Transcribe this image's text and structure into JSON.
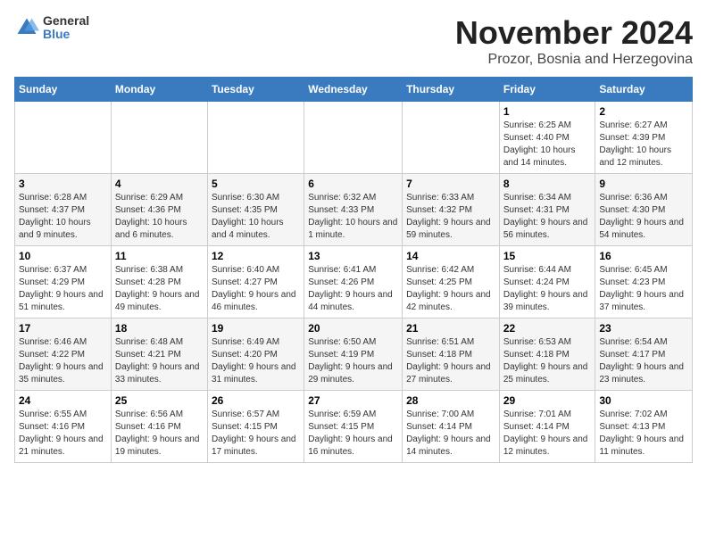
{
  "logo": {
    "general": "General",
    "blue": "Blue"
  },
  "header": {
    "title": "November 2024",
    "subtitle": "Prozor, Bosnia and Herzegovina"
  },
  "weekdays": [
    "Sunday",
    "Monday",
    "Tuesday",
    "Wednesday",
    "Thursday",
    "Friday",
    "Saturday"
  ],
  "weeks": [
    [
      {
        "day": "",
        "details": ""
      },
      {
        "day": "",
        "details": ""
      },
      {
        "day": "",
        "details": ""
      },
      {
        "day": "",
        "details": ""
      },
      {
        "day": "",
        "details": ""
      },
      {
        "day": "1",
        "details": "Sunrise: 6:25 AM\nSunset: 4:40 PM\nDaylight: 10 hours and 14 minutes."
      },
      {
        "day": "2",
        "details": "Sunrise: 6:27 AM\nSunset: 4:39 PM\nDaylight: 10 hours and 12 minutes."
      }
    ],
    [
      {
        "day": "3",
        "details": "Sunrise: 6:28 AM\nSunset: 4:37 PM\nDaylight: 10 hours and 9 minutes."
      },
      {
        "day": "4",
        "details": "Sunrise: 6:29 AM\nSunset: 4:36 PM\nDaylight: 10 hours and 6 minutes."
      },
      {
        "day": "5",
        "details": "Sunrise: 6:30 AM\nSunset: 4:35 PM\nDaylight: 10 hours and 4 minutes."
      },
      {
        "day": "6",
        "details": "Sunrise: 6:32 AM\nSunset: 4:33 PM\nDaylight: 10 hours and 1 minute."
      },
      {
        "day": "7",
        "details": "Sunrise: 6:33 AM\nSunset: 4:32 PM\nDaylight: 9 hours and 59 minutes."
      },
      {
        "day": "8",
        "details": "Sunrise: 6:34 AM\nSunset: 4:31 PM\nDaylight: 9 hours and 56 minutes."
      },
      {
        "day": "9",
        "details": "Sunrise: 6:36 AM\nSunset: 4:30 PM\nDaylight: 9 hours and 54 minutes."
      }
    ],
    [
      {
        "day": "10",
        "details": "Sunrise: 6:37 AM\nSunset: 4:29 PM\nDaylight: 9 hours and 51 minutes."
      },
      {
        "day": "11",
        "details": "Sunrise: 6:38 AM\nSunset: 4:28 PM\nDaylight: 9 hours and 49 minutes."
      },
      {
        "day": "12",
        "details": "Sunrise: 6:40 AM\nSunset: 4:27 PM\nDaylight: 9 hours and 46 minutes."
      },
      {
        "day": "13",
        "details": "Sunrise: 6:41 AM\nSunset: 4:26 PM\nDaylight: 9 hours and 44 minutes."
      },
      {
        "day": "14",
        "details": "Sunrise: 6:42 AM\nSunset: 4:25 PM\nDaylight: 9 hours and 42 minutes."
      },
      {
        "day": "15",
        "details": "Sunrise: 6:44 AM\nSunset: 4:24 PM\nDaylight: 9 hours and 39 minutes."
      },
      {
        "day": "16",
        "details": "Sunrise: 6:45 AM\nSunset: 4:23 PM\nDaylight: 9 hours and 37 minutes."
      }
    ],
    [
      {
        "day": "17",
        "details": "Sunrise: 6:46 AM\nSunset: 4:22 PM\nDaylight: 9 hours and 35 minutes."
      },
      {
        "day": "18",
        "details": "Sunrise: 6:48 AM\nSunset: 4:21 PM\nDaylight: 9 hours and 33 minutes."
      },
      {
        "day": "19",
        "details": "Sunrise: 6:49 AM\nSunset: 4:20 PM\nDaylight: 9 hours and 31 minutes."
      },
      {
        "day": "20",
        "details": "Sunrise: 6:50 AM\nSunset: 4:19 PM\nDaylight: 9 hours and 29 minutes."
      },
      {
        "day": "21",
        "details": "Sunrise: 6:51 AM\nSunset: 4:18 PM\nDaylight: 9 hours and 27 minutes."
      },
      {
        "day": "22",
        "details": "Sunrise: 6:53 AM\nSunset: 4:18 PM\nDaylight: 9 hours and 25 minutes."
      },
      {
        "day": "23",
        "details": "Sunrise: 6:54 AM\nSunset: 4:17 PM\nDaylight: 9 hours and 23 minutes."
      }
    ],
    [
      {
        "day": "24",
        "details": "Sunrise: 6:55 AM\nSunset: 4:16 PM\nDaylight: 9 hours and 21 minutes."
      },
      {
        "day": "25",
        "details": "Sunrise: 6:56 AM\nSunset: 4:16 PM\nDaylight: 9 hours and 19 minutes."
      },
      {
        "day": "26",
        "details": "Sunrise: 6:57 AM\nSunset: 4:15 PM\nDaylight: 9 hours and 17 minutes."
      },
      {
        "day": "27",
        "details": "Sunrise: 6:59 AM\nSunset: 4:15 PM\nDaylight: 9 hours and 16 minutes."
      },
      {
        "day": "28",
        "details": "Sunrise: 7:00 AM\nSunset: 4:14 PM\nDaylight: 9 hours and 14 minutes."
      },
      {
        "day": "29",
        "details": "Sunrise: 7:01 AM\nSunset: 4:14 PM\nDaylight: 9 hours and 12 minutes."
      },
      {
        "day": "30",
        "details": "Sunrise: 7:02 AM\nSunset: 4:13 PM\nDaylight: 9 hours and 11 minutes."
      }
    ]
  ]
}
